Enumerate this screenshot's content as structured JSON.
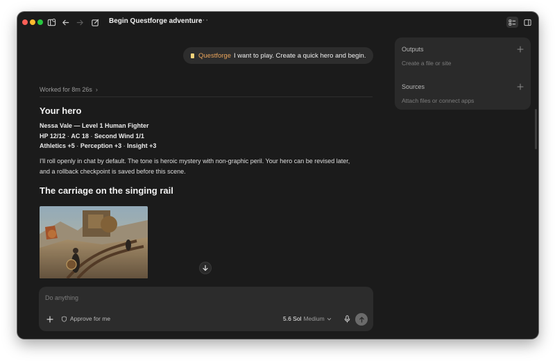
{
  "window": {
    "title": "Begin Questforge adventure",
    "more": "···"
  },
  "colors": {
    "close": "#fe5f57",
    "minimize": "#febb2e",
    "zoom": "#28c840",
    "accent_tag": "#e8a35a",
    "background": "#1b1b1b"
  },
  "titlebar_icons": [
    "sidebar-toggle-icon",
    "back-arrow-icon",
    "forward-arrow-icon",
    "new-chat-icon",
    "list-view-icon",
    "panel-toggle-icon"
  ],
  "user_message": {
    "tag": "Questforge",
    "text": "I want to play. Create a quick hero and begin."
  },
  "worked": {
    "label": "Worked for 8m 26s",
    "chevron": "›"
  },
  "response": {
    "hero_heading": "Your hero",
    "hero_line1": "Nessa Vale — Level 1 Human Fighter",
    "hero_hp": "HP 12/12",
    "hero_ac": "AC 18",
    "hero_wind": "Second Wind 1/1",
    "hero_athletics": "Athletics +5",
    "hero_perception": "Perception +3",
    "hero_insight": "Insight +3",
    "separator": "·",
    "paragraph_line1": "I'll roll openly in chat by default. The tone is heroic mystery with non-graphic peril. Your hero can be revised later,",
    "paragraph_line2": "and a rollback checkpoint is saved before this scene.",
    "scene_heading": "The carriage on the singing rail"
  },
  "composer": {
    "placeholder": "Do anything",
    "value": "",
    "approve_label": "Approve for me",
    "model_name": "5.6 Sol",
    "model_effort": "Medium"
  },
  "side_panel": {
    "outputs_label": "Outputs",
    "outputs_hint": "Create a file or site",
    "sources_label": "Sources",
    "sources_hint": "Attach files or connect apps"
  }
}
